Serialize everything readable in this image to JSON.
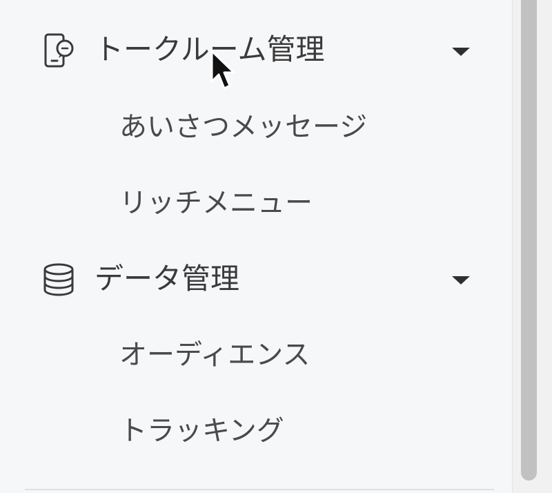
{
  "sidebar": {
    "sections": [
      {
        "label": "トークルーム管理",
        "icon": "chat-phone-icon",
        "expanded": true,
        "items": [
          "あいさつメッセージ",
          "リッチメニュー"
        ]
      },
      {
        "label": "データ管理",
        "icon": "database-icon",
        "expanded": true,
        "items": [
          "オーディエンス",
          "トラッキング"
        ]
      }
    ]
  },
  "cursor": {
    "icon": "mouse-pointer-icon"
  },
  "colors": {
    "background": "#f6f7f9",
    "text": "#3a3a3a",
    "scrollbar_thumb": "#c1c1c1"
  }
}
